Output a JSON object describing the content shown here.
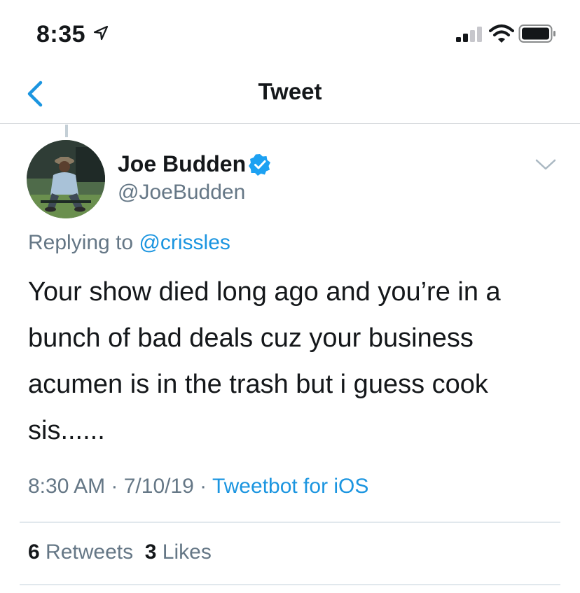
{
  "status_bar": {
    "time": "8:35"
  },
  "nav": {
    "title": "Tweet"
  },
  "tweet": {
    "author_name": "Joe Budden",
    "author_handle": "@JoeBudden",
    "replying_prefix": "Replying to",
    "replying_handle": "@crissles",
    "text": "Your show died long ago and you’re in a bunch of bad deals cuz your business acumen is in the trash but i guess cook sis......",
    "time": "8:30 AM",
    "date": "7/10/19",
    "separator": " · ",
    "source": "Tweetbot for iOS",
    "retweets_count": "6",
    "retweets_label": "Retweets",
    "likes_count": "3",
    "likes_label": "Likes"
  },
  "colors": {
    "accent": "#1b95e0",
    "muted": "#657786",
    "text": "#14171a",
    "divider": "#e1e8ed"
  },
  "icons": [
    "location-arrow-icon",
    "signal-icon",
    "wifi-icon",
    "battery-icon",
    "back-chevron-icon",
    "verified-badge-icon",
    "chevron-down-icon"
  ]
}
